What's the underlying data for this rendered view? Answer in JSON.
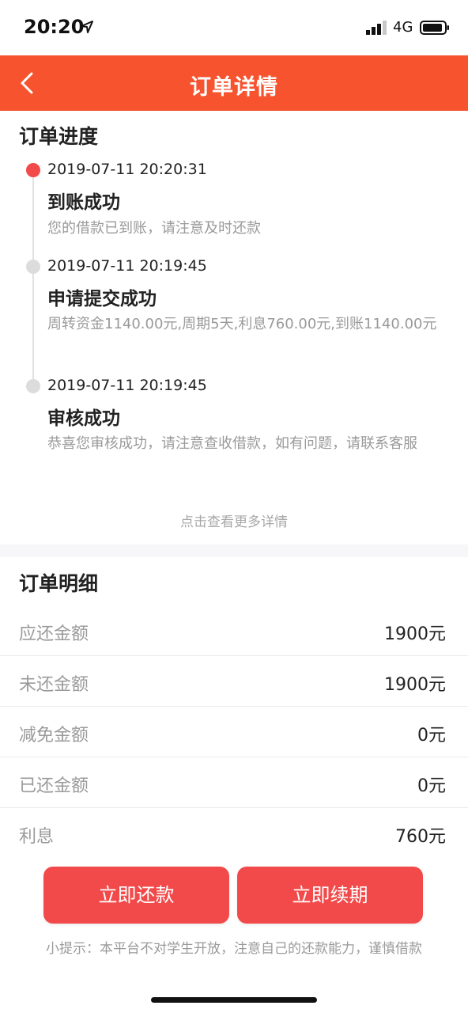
{
  "status_bar": {
    "time": "20:20",
    "network": "4G",
    "icons": [
      "location-arrow-icon",
      "signal-bars-icon",
      "battery-icon"
    ]
  },
  "nav": {
    "title": "订单详情",
    "back_icon": "chevron-left-icon"
  },
  "progress": {
    "title": "订单进度",
    "events": [
      {
        "time": "2019-07-11 20:20:31",
        "title": "到账成功",
        "desc": "您的借款已到账，请注意及时还款",
        "active": true
      },
      {
        "time": "2019-07-11 20:19:45",
        "title": "申请提交成功",
        "desc": "周转资金1140.00元,周期5天,利息760.00元,到账1140.00元",
        "active": false
      },
      {
        "time": "2019-07-11 20:19:45",
        "title": "审核成功",
        "desc": "恭喜您审核成功，请注意查收借款，如有问题，请联系客服",
        "active": false
      }
    ],
    "more_link": "点击查看更多详情"
  },
  "detail": {
    "title": "订单明细",
    "rows": [
      {
        "label": "应还金额",
        "value": "1900元"
      },
      {
        "label": "未还金额",
        "value": "1900元"
      },
      {
        "label": "减免金额",
        "value": "0元"
      },
      {
        "label": "已还金额",
        "value": "0元"
      },
      {
        "label": "利息",
        "value": "760元"
      }
    ]
  },
  "actions": {
    "repay_label": "立即还款",
    "renew_label": "立即续期"
  },
  "tip": "小提示：本平台不对学生开放，注意自己的还款能力，谨慎借款",
  "colors": {
    "accent": "#f6532e",
    "button": "#f24a4a",
    "active_dot": "#f24a4a"
  }
}
